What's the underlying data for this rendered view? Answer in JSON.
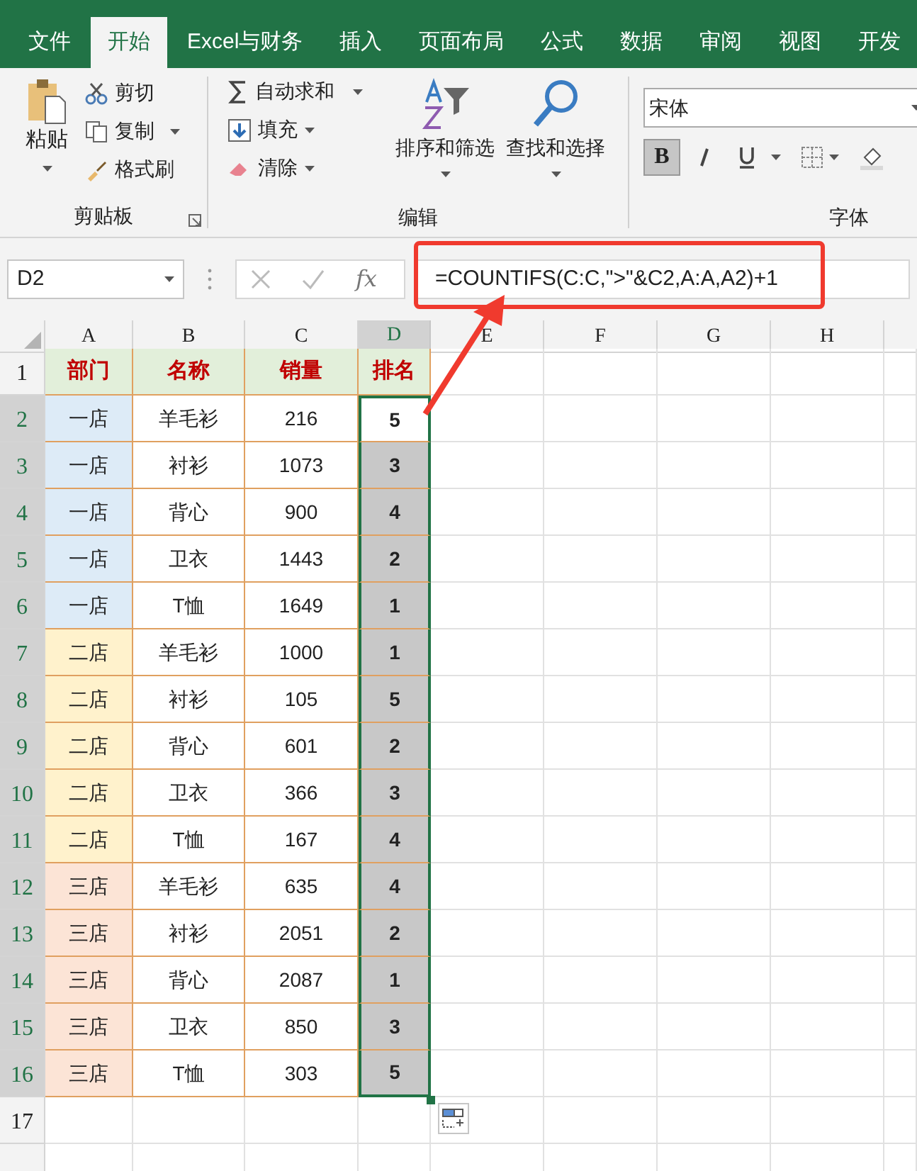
{
  "tabs": [
    {
      "label": "文件",
      "selected": false
    },
    {
      "label": "开始",
      "selected": true
    },
    {
      "label": "Excel与财务",
      "selected": false
    },
    {
      "label": "插入",
      "selected": false
    },
    {
      "label": "页面布局",
      "selected": false
    },
    {
      "label": "公式",
      "selected": false
    },
    {
      "label": "数据",
      "selected": false
    },
    {
      "label": "审阅",
      "selected": false
    },
    {
      "label": "视图",
      "selected": false
    },
    {
      "label": "开发",
      "selected": false
    }
  ],
  "ribbon": {
    "clipboard": {
      "paste": "粘贴",
      "cut": "剪切",
      "copy": "复制",
      "format_painter": "格式刷",
      "label": "剪贴板"
    },
    "editing": {
      "autosum": "自动求和",
      "fill": "填充",
      "clear": "清除",
      "sort_filter": "排序和筛选",
      "find_select": "查找和选择",
      "label": "编辑"
    },
    "font": {
      "font_name": "宋体",
      "bold_label": "B",
      "bold_on": true,
      "italic_on": false,
      "underline_on": false,
      "label": "字体"
    }
  },
  "formula_bar": {
    "name_box": "D2",
    "fx_label": "fx",
    "formula": "=COUNTIFS(C:C,\">\"&C2,A:A,A2)+1"
  },
  "columns": [
    {
      "label": "A",
      "selected": false
    },
    {
      "label": "B",
      "selected": false
    },
    {
      "label": "C",
      "selected": false
    },
    {
      "label": "D",
      "selected": true
    },
    {
      "label": "E",
      "selected": false
    },
    {
      "label": "F",
      "selected": false
    },
    {
      "label": "G",
      "selected": false
    },
    {
      "label": "H",
      "selected": false
    }
  ],
  "header_row": {
    "number": "1",
    "cells": [
      "部门",
      "名称",
      "销量",
      "排名"
    ]
  },
  "rows": [
    {
      "number": "2",
      "dept": "一店",
      "name": "羊毛衫",
      "sales": "216",
      "rank": "5",
      "color": "#ddebf7",
      "selected": true,
      "active": true
    },
    {
      "number": "3",
      "dept": "一店",
      "name": "衬衫",
      "sales": "1073",
      "rank": "3",
      "color": "#ddebf7",
      "selected": true,
      "active": false
    },
    {
      "number": "4",
      "dept": "一店",
      "name": "背心",
      "sales": "900",
      "rank": "4",
      "color": "#ddebf7",
      "selected": true,
      "active": false
    },
    {
      "number": "5",
      "dept": "一店",
      "name": "卫衣",
      "sales": "1443",
      "rank": "2",
      "color": "#ddebf7",
      "selected": true,
      "active": false
    },
    {
      "number": "6",
      "dept": "一店",
      "name": "T恤",
      "sales": "1649",
      "rank": "1",
      "color": "#ddebf7",
      "selected": true,
      "active": false
    },
    {
      "number": "7",
      "dept": "二店",
      "name": "羊毛衫",
      "sales": "1000",
      "rank": "1",
      "color": "#fff2cc",
      "selected": true,
      "active": false
    },
    {
      "number": "8",
      "dept": "二店",
      "name": "衬衫",
      "sales": "105",
      "rank": "5",
      "color": "#fff2cc",
      "selected": true,
      "active": false
    },
    {
      "number": "9",
      "dept": "二店",
      "name": "背心",
      "sales": "601",
      "rank": "2",
      "color": "#fff2cc",
      "selected": true,
      "active": false
    },
    {
      "number": "10",
      "dept": "二店",
      "name": "卫衣",
      "sales": "366",
      "rank": "3",
      "color": "#fff2cc",
      "selected": true,
      "active": false
    },
    {
      "number": "11",
      "dept": "二店",
      "name": "T恤",
      "sales": "167",
      "rank": "4",
      "color": "#fff2cc",
      "selected": true,
      "active": false
    },
    {
      "number": "12",
      "dept": "三店",
      "name": "羊毛衫",
      "sales": "635",
      "rank": "4",
      "color": "#fce4d6",
      "selected": true,
      "active": false
    },
    {
      "number": "13",
      "dept": "三店",
      "name": "衬衫",
      "sales": "2051",
      "rank": "2",
      "color": "#fce4d6",
      "selected": true,
      "active": false
    },
    {
      "number": "14",
      "dept": "三店",
      "name": "背心",
      "sales": "2087",
      "rank": "1",
      "color": "#fce4d6",
      "selected": true,
      "active": false
    },
    {
      "number": "15",
      "dept": "三店",
      "name": "卫衣",
      "sales": "850",
      "rank": "3",
      "color": "#fce4d6",
      "selected": true,
      "active": false
    },
    {
      "number": "16",
      "dept": "三店",
      "name": "T恤",
      "sales": "303",
      "rank": "5",
      "color": "#fce4d6",
      "selected": true,
      "active": false
    }
  ],
  "empty_rows": [
    "17"
  ]
}
